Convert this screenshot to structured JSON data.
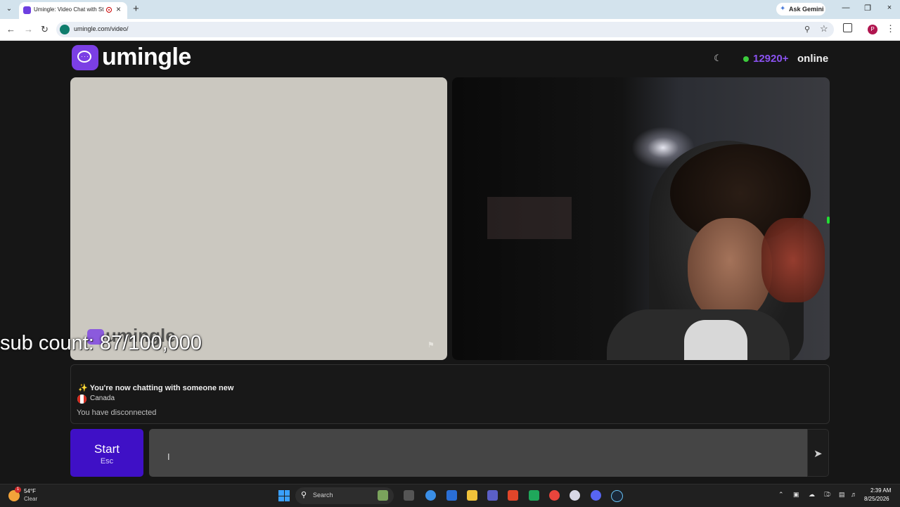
{
  "browser": {
    "tab_title": "Umingle: Video Chat with St",
    "url": "umingle.com/video/",
    "gemini_label": "Ask Gemini",
    "profile_initial": "P",
    "icons": [
      "tab-menu-icon",
      "favicon-icon",
      "recording-icon",
      "close-icon",
      "new-tab-icon",
      "back-icon",
      "forward-icon",
      "reload-icon",
      "site-info-icon",
      "zoom-icon",
      "bookmark-star-icon",
      "extensions-icon",
      "profile-avatar",
      "menu-icon"
    ]
  },
  "header": {
    "brand": "umingle",
    "online_count": "12920+",
    "online_label": "online",
    "accent_color": "#8a52f0",
    "online_dot_color": "#3ccb3c"
  },
  "video": {
    "watermark": "umingle"
  },
  "overlay": {
    "sub_count": "sub count: 87/100,000"
  },
  "chat": {
    "new_chat_message": "You're now chatting with someone new",
    "country": "Canada",
    "status": "You have disconnected"
  },
  "controls": {
    "start_label": "Start",
    "start_shortcut": "Esc",
    "message_placeholder": "",
    "start_color": "#3f10c6"
  },
  "taskbar": {
    "weather_temp": "54°F",
    "weather_condition": "Clear",
    "weather_badge": "1",
    "search_label": "Search",
    "time": "2:39 AM",
    "date": "8/25/2026"
  }
}
